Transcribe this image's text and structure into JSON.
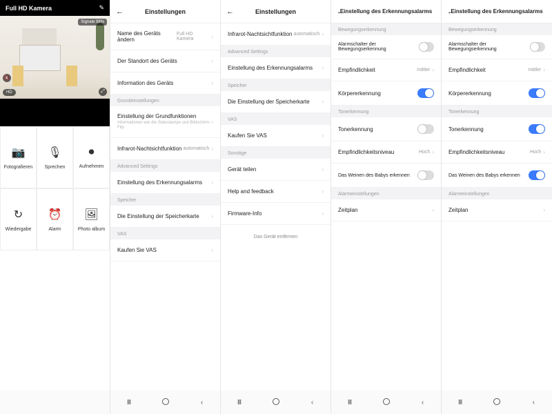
{
  "col1": {
    "title": "Full HD Kamera",
    "signalLabel": "Signale 98%",
    "hd": "HD",
    "actions": [
      {
        "icon": "📷",
        "label": "Fotografieren"
      },
      {
        "icon": "🎙",
        "label": "Sprechen"
      },
      {
        "icon": "⏺",
        "label": "Aufnehmen"
      },
      {
        "icon": "↻",
        "label": "Wiedergabe"
      },
      {
        "icon": "⏰",
        "label": "Alarm"
      },
      {
        "icon": "🖼",
        "label": "Photo album"
      }
    ]
  },
  "col2": {
    "title": "Einstellungen",
    "rows": [
      {
        "label": "Name des Geräts ändern",
        "value": "Full HD Kamera"
      },
      {
        "label": "Der Standort des Geräts"
      },
      {
        "label": "Information des Geräts"
      }
    ],
    "sec_basic": "Grundeinstellungen",
    "basic": {
      "label": "Einstellung der Grundfunktionen",
      "sub": "Informationen wie die Statuslampe und Bildschirm-Flip"
    },
    "ir": {
      "label": "Infrarot-Nachtsichtfunktion",
      "value": "automatisch"
    },
    "sec_adv": "Advanced Settings",
    "adv": {
      "label": "Einstellung des Erkennungsalarms"
    },
    "sec_store": "Speicher",
    "store": {
      "label": "Die Einstellung der Speicherkarte"
    },
    "sec_vas": "VAS",
    "vas": {
      "label": "Kaufen Sie VAS"
    }
  },
  "col3": {
    "title": "Einstellungen",
    "ir": {
      "label": "Infrarot-Nachtsichtfunktion",
      "value": "automatisch"
    },
    "sec_adv": "Advanced Settings",
    "adv": {
      "label": "Einstellung des Erkennungsalarms"
    },
    "sec_store": "Speicher",
    "store": {
      "label": "Die Einstellung der Speicherkarte"
    },
    "sec_vas": "VAS",
    "vas": {
      "label": "Kaufen Sie VAS"
    },
    "sec_other": "Sonstige",
    "share": {
      "label": "Gerät teilen"
    },
    "help": {
      "label": "Help and feedback"
    },
    "fw": {
      "label": "Firmware-Info"
    },
    "remove": "Das Gerät entfernen"
  },
  "alarm": {
    "title": "Einstellung des Erkennungsalarms",
    "sec_motion": "Bewegungserkennung",
    "motion_switch": "Alarmschalter der Bewegungserkennung",
    "sensitivity": "Empfindlichkeit",
    "sens_val": "mittler",
    "body": "Körpererkennung",
    "sec_sound": "Tonerkennung",
    "sound": "Tonerkennung",
    "sound_level": "Empfindlichkeitsniveau",
    "level_val": "Hoch",
    "baby": "Das Weinen des Babys erkennen",
    "sec_alarm": "Alarmeinstellungen",
    "schedule": "Zeitplan"
  },
  "toggles": {
    "col4": {
      "motion": "off",
      "body": "on",
      "sound": "off",
      "baby": "off"
    },
    "col5": {
      "motion": "off",
      "body": "on",
      "sound": "on",
      "baby": "on"
    }
  }
}
